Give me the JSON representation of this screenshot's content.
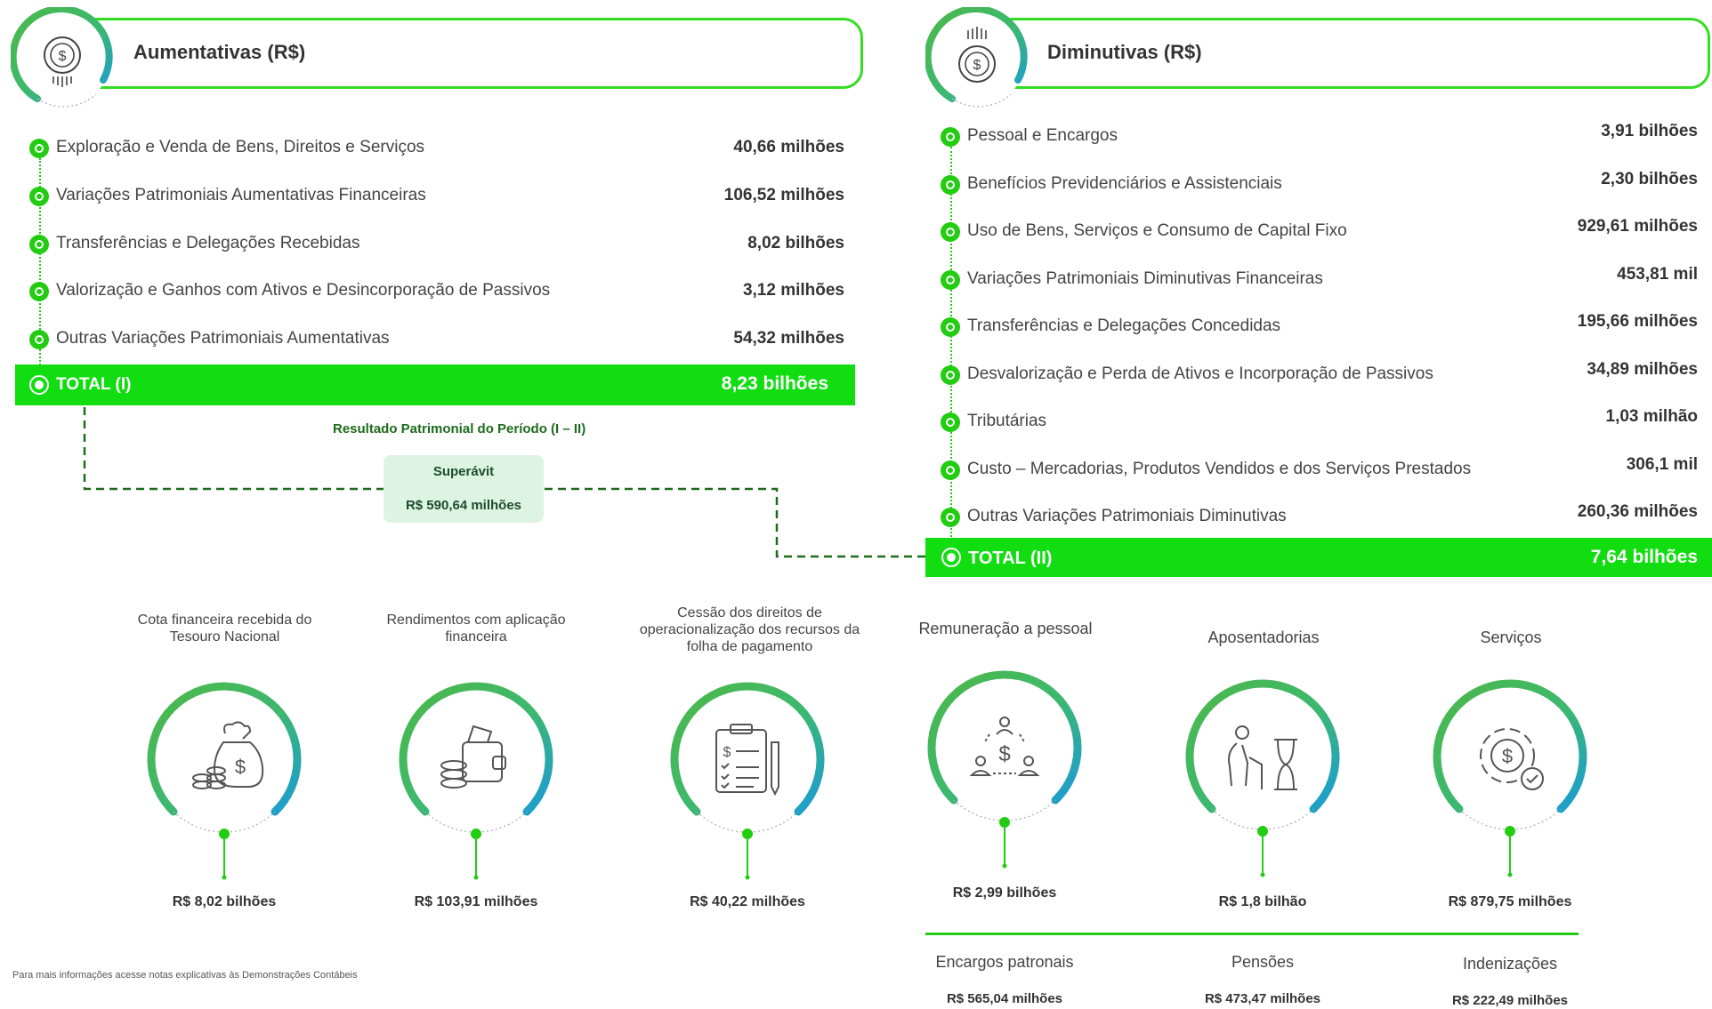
{
  "aumentativas": {
    "title": "Aumentativas (R$)",
    "items": [
      {
        "label": "Exploração e Venda de Bens, Direitos e Serviços",
        "value": "40,66 milhões"
      },
      {
        "label": "Variações Patrimoniais Aumentativas Financeiras",
        "value": "106,52 milhões"
      },
      {
        "label": "Transferências e Delegações Recebidas",
        "value": "8,02 bilhões"
      },
      {
        "label": "Valorização e Ganhos com Ativos e Desincorporação de Passivos",
        "value": "3,12 milhões"
      },
      {
        "label": "Outras Variações Patrimoniais Aumentativas",
        "value": "54,32 milhões"
      }
    ],
    "total_label": "TOTAL (I)",
    "total_value": "8,23 bilhões"
  },
  "diminutivas": {
    "title": "Diminutivas (R$)",
    "items": [
      {
        "label": "Pessoal e Encargos",
        "value": "3,91 bilhões"
      },
      {
        "label": "Benefícios Previdenciários e Assistenciais",
        "value": "2,30 bilhões"
      },
      {
        "label": "Uso de Bens, Serviços e Consumo de Capital Fixo",
        "value": "929,61 milhões"
      },
      {
        "label": "Variações Patrimoniais Diminutivas Financeiras",
        "value": "453,81 mil"
      },
      {
        "label": "Transferências e Delegações Concedidas",
        "value": "195,66 milhões"
      },
      {
        "label": "Desvalorização e Perda de Ativos e Incorporação de Passivos",
        "value": "34,89 milhões"
      },
      {
        "label": "Tributárias",
        "value": "1,03 milhão"
      },
      {
        "label": "Custo – Mercadorias, Produtos Vendidos e dos Serviços Prestados",
        "value": "306,1 mil"
      },
      {
        "label": "Outras Variações Patrimoniais Diminutivas",
        "value": "260,36 milhões"
      }
    ],
    "total_label": "TOTAL (II)",
    "total_value": "7,64 bilhões"
  },
  "resultado": {
    "title": "Resultado Patrimonial do Período (I – II)",
    "status": "Superávit",
    "value": "R$ 590,64 milhões"
  },
  "receitas_destaque": [
    {
      "caption": "Cota financeira recebida do Tesouro Nacional",
      "value": "R$ 8,02 bilhões",
      "icon": "money-bag-icon"
    },
    {
      "caption": "Rendimentos com aplicação financeira",
      "value": "R$ 103,91 milhões",
      "icon": "wallet-icon"
    },
    {
      "caption": "Cessão dos direitos de operacionalização dos recursos da folha de pagamento",
      "value": "R$ 40,22 milhões",
      "icon": "clipboard-icon"
    }
  ],
  "despesas_destaque": [
    {
      "caption": "Remuneração a pessoal",
      "value": "R$ 2,99 bilhões",
      "icon": "people-money-icon"
    },
    {
      "caption": "Aposentadorias",
      "value": "R$ 1,8 bilhão",
      "icon": "elderly-hourglass-icon"
    },
    {
      "caption": "Serviços",
      "value": "R$ 879,75 milhões",
      "icon": "gear-money-icon"
    }
  ],
  "despesas_sub": [
    {
      "label": "Encargos patronais",
      "value": "R$ 565,04 milhões"
    },
    {
      "label": "Pensões",
      "value": "R$ 473,47 milhões"
    },
    {
      "label": "Indenizações",
      "value": "R$ 222,49 milhões"
    }
  ],
  "footnote": "Para mais informações acesse notas explicativas às Demonstrações Contábeis",
  "colors": {
    "green": "#11dd11",
    "dark_green": "#1d6b1d",
    "accent_blue": "#1aa0d8",
    "panel_bg": "#ddf3e3"
  }
}
